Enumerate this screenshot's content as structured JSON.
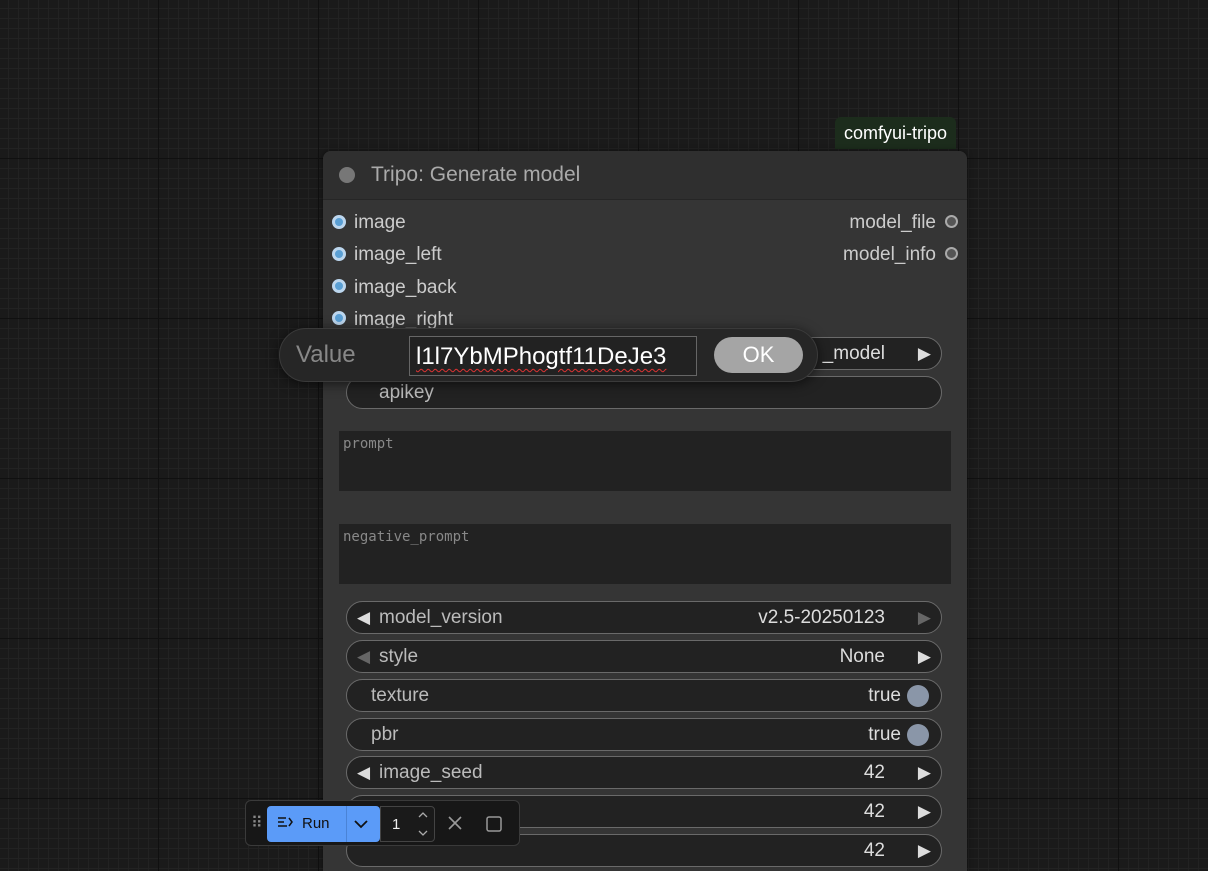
{
  "node": {
    "badge": "comfyui-tripo",
    "title": "Tripo: Generate model",
    "inputs": [
      "image",
      "image_left",
      "image_back",
      "image_right"
    ],
    "outputs": [
      "model_file",
      "model_info"
    ],
    "mode_value": "_model",
    "apikey_label": "apikey",
    "prompt_placeholder": "prompt",
    "negative_prompt_placeholder": "negative_prompt",
    "widgets": {
      "model_version": {
        "label": "model_version",
        "value": "v2.5-20250123"
      },
      "style": {
        "label": "style",
        "value": "None"
      },
      "texture": {
        "label": "texture",
        "value": "true"
      },
      "pbr": {
        "label": "pbr",
        "value": "true"
      },
      "image_seed": {
        "label": "image_seed",
        "value": "42"
      },
      "hidden_seed_1": {
        "value": "42"
      },
      "hidden_seed_2": {
        "value": "42"
      }
    }
  },
  "dialog": {
    "label": "Value",
    "input_value": "l1l7YbMPhogtf11DeJe3",
    "ok_label": "OK"
  },
  "toolbar": {
    "run_label": "Run",
    "count": "1"
  },
  "colors": {
    "run_button": "#5b9bf8",
    "input_slot": "#5a9fd4",
    "toggle_on": "#8a96a8"
  }
}
